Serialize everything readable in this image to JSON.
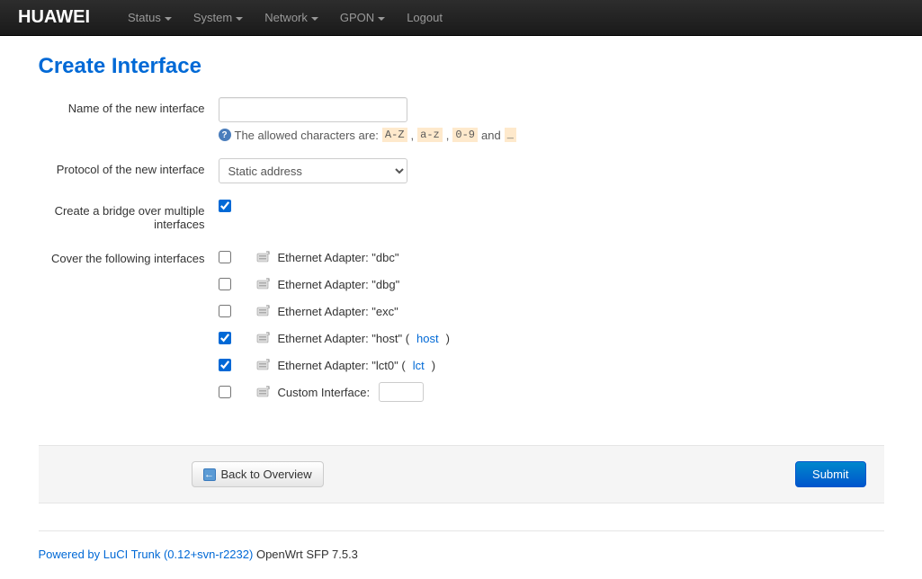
{
  "navbar": {
    "brand": "HUAWEI",
    "items": [
      {
        "label": "Status",
        "dropdown": true
      },
      {
        "label": "System",
        "dropdown": true
      },
      {
        "label": "Network",
        "dropdown": true
      },
      {
        "label": "GPON",
        "dropdown": true
      },
      {
        "label": "Logout",
        "dropdown": false
      }
    ]
  },
  "page": {
    "title": "Create Interface"
  },
  "form": {
    "name_label": "Name of the new interface",
    "name_value": "",
    "help_prefix": "The allowed characters are:",
    "help_chips": [
      "A-Z",
      "a-z",
      "0-9"
    ],
    "help_and": "and",
    "help_tail": "_",
    "protocol_label": "Protocol of the new interface",
    "protocol_selected": "Static address",
    "bridge_label": "Create a bridge over multiple interfaces",
    "bridge_checked": true,
    "cover_label": "Cover the following interfaces",
    "interfaces": [
      {
        "text": "Ethernet Adapter: \"dbc\"",
        "checked": false,
        "link": null
      },
      {
        "text": "Ethernet Adapter: \"dbg\"",
        "checked": false,
        "link": null
      },
      {
        "text": "Ethernet Adapter: \"exc\"",
        "checked": false,
        "link": null
      },
      {
        "text": "Ethernet Adapter: \"host\" (",
        "checked": true,
        "link": "host",
        "close": ")"
      },
      {
        "text": "Ethernet Adapter: \"lct0\" (",
        "checked": true,
        "link": "lct",
        "close": ")"
      }
    ],
    "custom_label": "Custom Interface:",
    "custom_value": ""
  },
  "actions": {
    "back": "Back to Overview",
    "submit": "Submit"
  },
  "footer": {
    "luci": "Powered by LuCI Trunk (0.12+svn-r2232)",
    "os": "OpenWrt SFP 7.5.3"
  }
}
